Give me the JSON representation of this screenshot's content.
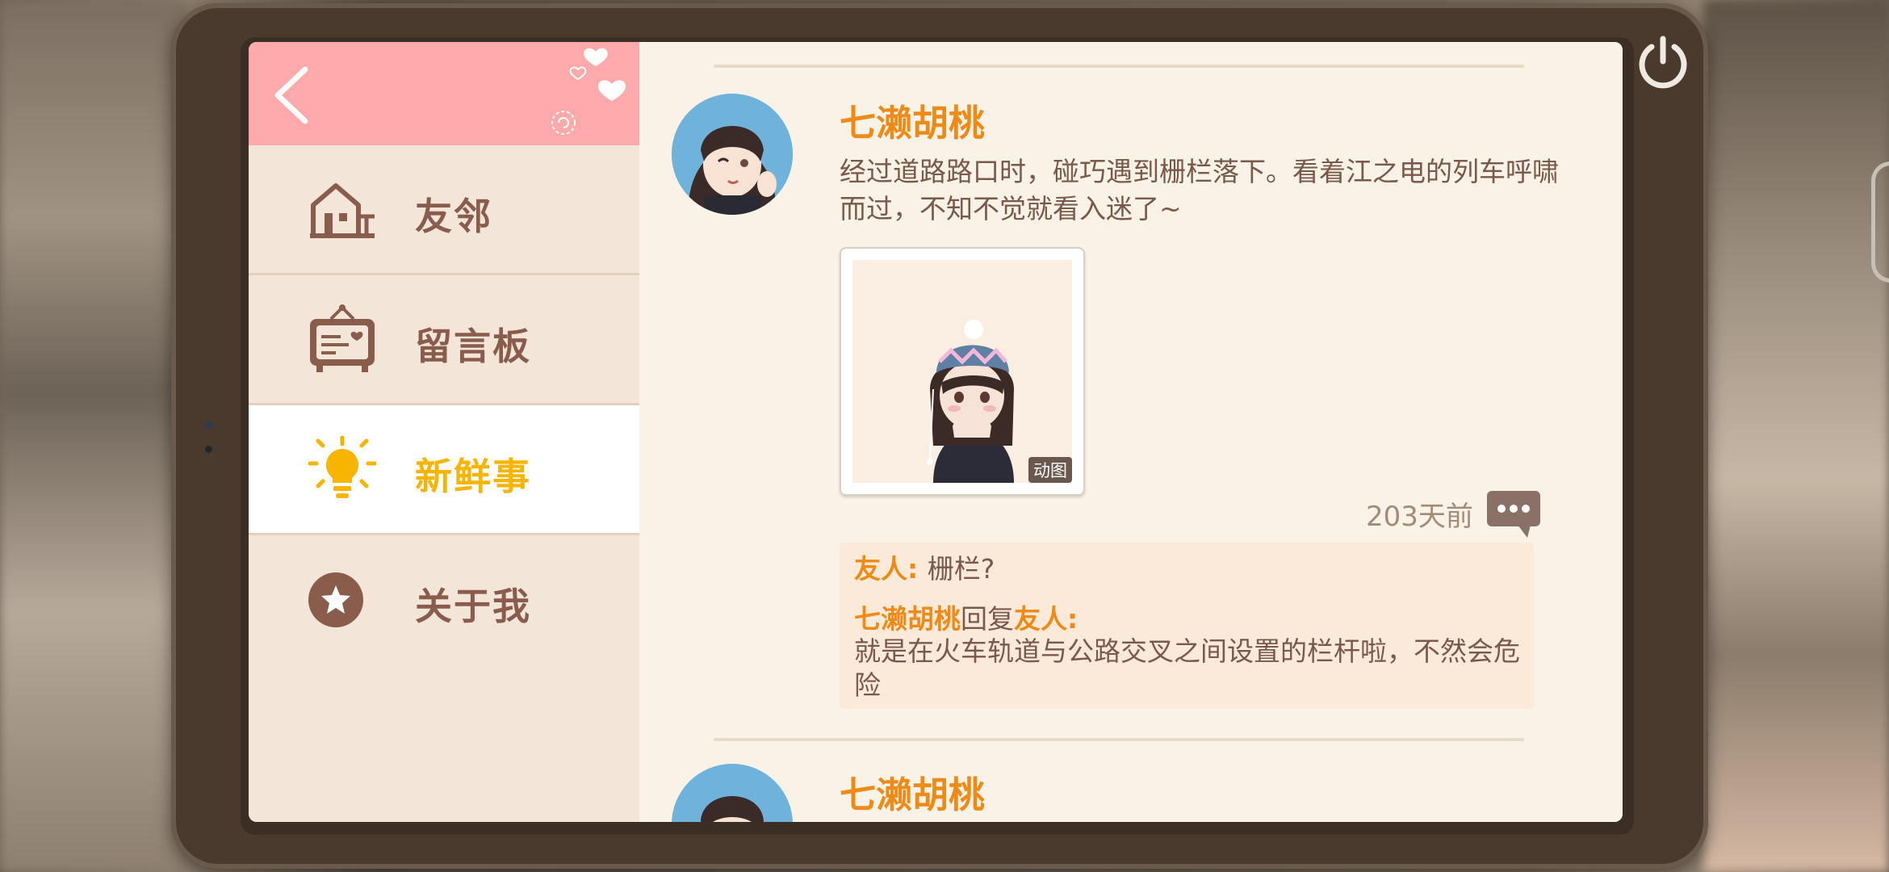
{
  "sidebar": {
    "items": [
      {
        "label": "友邻",
        "icon": "house-icon"
      },
      {
        "label": "留言板",
        "icon": "message-board-icon"
      },
      {
        "label": "新鲜事",
        "icon": "lightbulb-icon",
        "active": true
      },
      {
        "label": "关于我",
        "icon": "star-badge-icon"
      }
    ]
  },
  "feed": {
    "posts": [
      {
        "author": "七濑胡桃",
        "text": "经过道路路口时，碰巧遇到栅栏落下。看着江之电的列车呼啸而过，不知不觉就看入迷了~",
        "image_badge": "动图",
        "time": "203天前",
        "comments": [
          {
            "author": "友人",
            "sep": ": ",
            "text": "栅栏?"
          },
          {
            "author": "七濑胡桃",
            "reply_word": "回复",
            "target": "友人",
            "sep": ":",
            "text": "就是在火车轨道与公路交叉之间设置的栏杆啦，不然会危险"
          }
        ]
      },
      {
        "author": "七濑胡桃"
      }
    ]
  },
  "colors": {
    "accent_orange": "#f08a16",
    "active_yellow": "#f7b400",
    "header_pink": "#ffaaaa",
    "text_brown": "#7a584a"
  }
}
